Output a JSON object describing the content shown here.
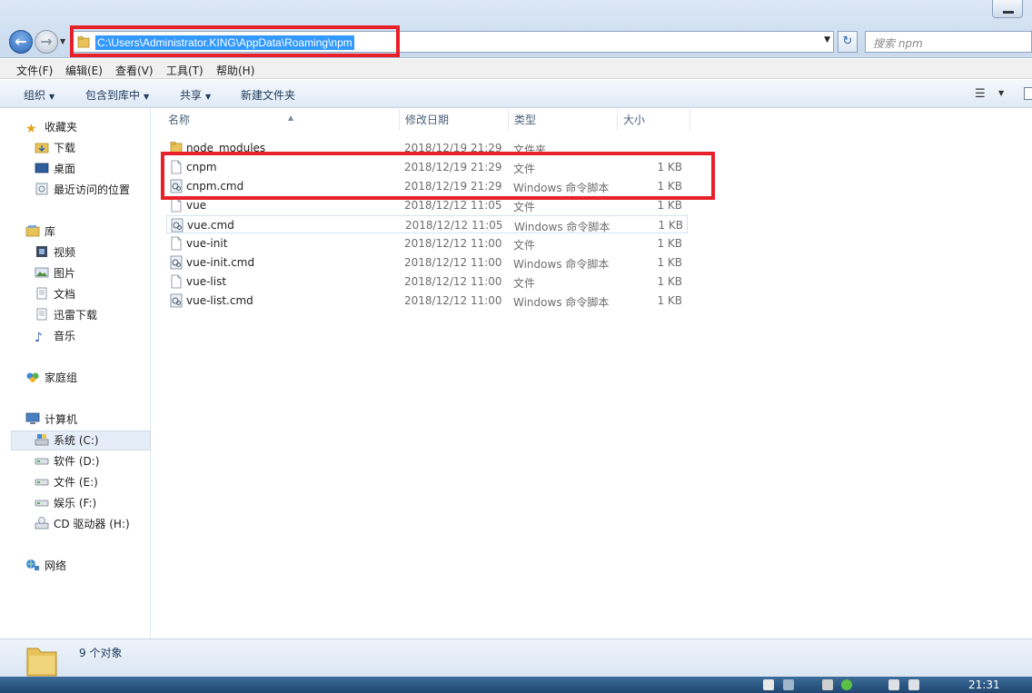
{
  "address": {
    "path": "C:\\Users\\Administrator.KING\\AppData\\Roaming\\npm",
    "search_placeholder": "搜索 npm"
  },
  "menu": [
    "文件(F)",
    "编辑(E)",
    "查看(V)",
    "工具(T)",
    "帮助(H)"
  ],
  "toolbar": {
    "organize": "组织",
    "include_library": "包含到库中",
    "share": "共享",
    "new_folder": "新建文件夹"
  },
  "nav": {
    "favorites": "收藏夹",
    "downloads": "下载",
    "desktop": "桌面",
    "recent": "最近访问的位置",
    "libraries": "库",
    "videos": "视频",
    "pictures": "图片",
    "documents": "文档",
    "xunlei": "迅雷下载",
    "music": "音乐",
    "homegroup": "家庭组",
    "computer": "计算机",
    "drive_c": "系统 (C:)",
    "drive_d": "软件 (D:)",
    "drive_e": "文件 (E:)",
    "drive_f": "娱乐 (F:)",
    "drive_h": "CD 驱动器 (H:)",
    "network": "网络"
  },
  "columns": {
    "name": "名称",
    "date": "修改日期",
    "type": "类型",
    "size": "大小"
  },
  "files": [
    {
      "name": "node_modules",
      "date": "2018/12/19 21:29",
      "type": "文件夹",
      "size": "",
      "icon": "folder-icon"
    },
    {
      "name": "cnpm",
      "date": "2018/12/19 21:29",
      "type": "文件",
      "size": "1 KB",
      "icon": "file-icon"
    },
    {
      "name": "cnpm.cmd",
      "date": "2018/12/19 21:29",
      "type": "Windows 命令脚本",
      "size": "1 KB",
      "icon": "cmd-script-icon"
    },
    {
      "name": "vue",
      "date": "2018/12/12 11:05",
      "type": "文件",
      "size": "1 KB",
      "icon": "file-icon"
    },
    {
      "name": "vue.cmd",
      "date": "2018/12/12 11:05",
      "type": "Windows 命令脚本",
      "size": "1 KB",
      "icon": "cmd-script-icon"
    },
    {
      "name": "vue-init",
      "date": "2018/12/12 11:00",
      "type": "文件",
      "size": "1 KB",
      "icon": "file-icon"
    },
    {
      "name": "vue-init.cmd",
      "date": "2018/12/12 11:00",
      "type": "Windows 命令脚本",
      "size": "1 KB",
      "icon": "cmd-script-icon"
    },
    {
      "name": "vue-list",
      "date": "2018/12/12 11:00",
      "type": "文件",
      "size": "1 KB",
      "icon": "file-icon"
    },
    {
      "name": "vue-list.cmd",
      "date": "2018/12/12 11:00",
      "type": "Windows 命令脚本",
      "size": "1 KB",
      "icon": "cmd-script-icon"
    }
  ],
  "details": {
    "count": "9 个对象"
  },
  "taskbar": {
    "time": "21:31"
  },
  "colors": {
    "highlight_box": "#e8202a",
    "selection": "#3399ff"
  }
}
